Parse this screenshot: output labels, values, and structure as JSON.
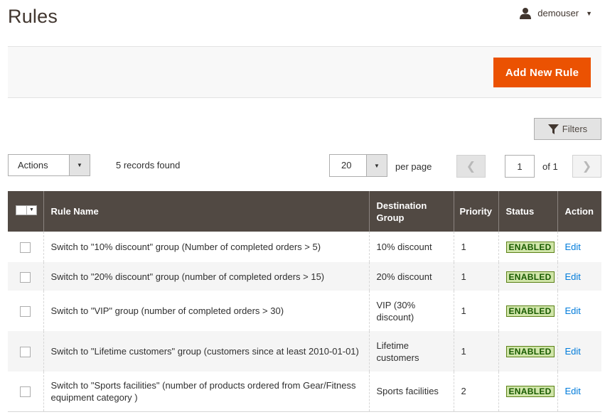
{
  "header": {
    "title": "Rules",
    "user": {
      "name": "demouser",
      "avatar_icon": "user-icon",
      "menu_icon": "caret-down-icon"
    }
  },
  "actionbar": {
    "add_button_label": "Add New Rule",
    "accent_color": "#eb5202"
  },
  "toolbar": {
    "filters_label": "Filters",
    "actions_label": "Actions",
    "records_found": "5 records found",
    "per_page_value": "20",
    "per_page_label": "per page",
    "current_page": "1",
    "total_pages_label": "of 1"
  },
  "grid": {
    "columns": [
      "Rule Name",
      "Destination Group",
      "Priority",
      "Status",
      "Action"
    ],
    "rows": [
      {
        "rule_name": "Switch to \"10% discount\" group (Number of completed orders > 5)",
        "destination_group": "10% discount",
        "priority": "1",
        "status": "ENABLED",
        "action": "Edit"
      },
      {
        "rule_name": "Switch to \"20% discount\" group (number of completed orders > 15)",
        "destination_group": "20% discount",
        "priority": "1",
        "status": "ENABLED",
        "action": "Edit"
      },
      {
        "rule_name": "Switch to \"VIP\" group (number of completed orders > 30)",
        "destination_group": "VIP (30% discount)",
        "priority": "1",
        "status": "ENABLED",
        "action": "Edit"
      },
      {
        "rule_name": "Switch to \"Lifetime customers\" group (customers since at least 2010-01-01)",
        "destination_group": "Lifetime customers",
        "priority": "1",
        "status": "ENABLED",
        "action": "Edit"
      },
      {
        "rule_name": "Switch to \"Sports facilities\" (number of products ordered from Gear/Fitness equipment category )",
        "destination_group": "Sports facilities",
        "priority": "2",
        "status": "ENABLED",
        "action": "Edit"
      }
    ]
  }
}
